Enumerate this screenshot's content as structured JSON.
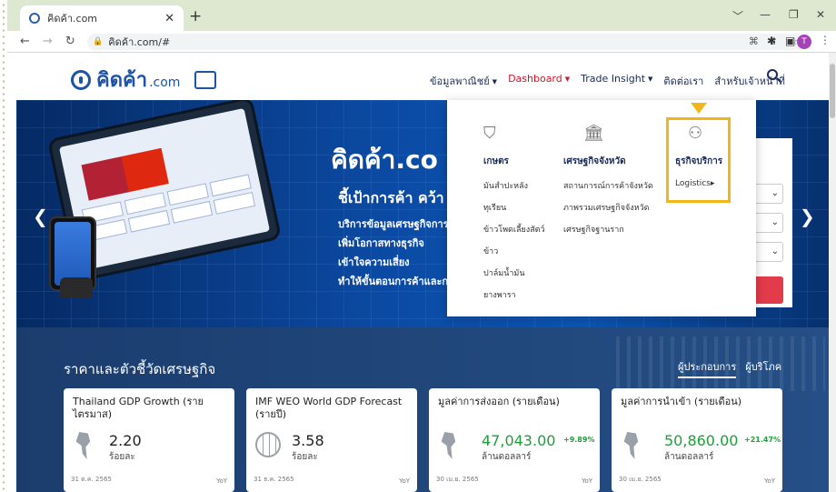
{
  "browser": {
    "tab_title": "คิดค้า.com",
    "tab_close": "✕",
    "new_tab": "+",
    "url": "คิดค้า.com/#",
    "window_controls": [
      "﹀",
      "—",
      "❐",
      "✕"
    ],
    "avatar_initial": "T"
  },
  "header": {
    "logo_text": "คิดค้า",
    "logo_suffix": ".com",
    "nav": [
      {
        "label": "ข้อมูลพาณิชย์",
        "has_caret": true
      },
      {
        "label": "Dashboard",
        "has_caret": true,
        "active": true
      },
      {
        "label": "Trade Insight",
        "has_caret": true
      },
      {
        "label": "ติดต่อเรา",
        "has_caret": false
      },
      {
        "label": "สำหรับเจ้าหน้าที่",
        "has_caret": false
      }
    ]
  },
  "hero": {
    "logo_text": "คิดค้า.co",
    "title": "ชี้เป้าการค้า คว้า",
    "lines": [
      "บริการข้อมูลเศรษฐกิจการ",
      "เพิ่มโอกาสทางธุรกิจ",
      "เข้าใจความเสี่ยง",
      "ทำให้ขั้นตอนการค้าและกา"
    ]
  },
  "dashboard_menu": {
    "columns": [
      {
        "heading": "เกษตร",
        "icon": "plant-icon",
        "items": [
          "มันสำปะหลัง",
          "ทุเรียน",
          "ข้าวโพดเลี้ยงสัตว์",
          "ข้าว",
          "ปาล์มน้ำมัน",
          "ยางพารา"
        ]
      },
      {
        "heading": "เศรษฐกิจจังหวัด",
        "icon": "government-building-icon",
        "items": [
          "สถานการณ์การค้าจังหวัด",
          "ภาพรวมเศรษฐกิจจังหวัด",
          "เศรษฐกิจฐานราก"
        ]
      },
      {
        "heading": "ธุรกิจบริการ",
        "icon": "people-service-icon",
        "items": [
          "Logistics"
        ]
      }
    ]
  },
  "stats": {
    "title": "ราคาและตัวชี้วัดเศรษฐกิจ",
    "tabs": [
      "ผู้ประกอบการ",
      "ผู้บริโภค"
    ],
    "cards": [
      {
        "title": "Thailand GDP Growth (รายไตรมาส)",
        "value": "2.20",
        "unit": "ร้อยละ",
        "change": "",
        "date": "31 ต.ค. 2565",
        "yoy": "YoY",
        "icon": "thailand-map-icon"
      },
      {
        "title": "IMF WEO World GDP Forecast (รายปี)",
        "value": "3.58",
        "unit": "ร้อยละ",
        "change": "",
        "date": "31 ธ.ค. 2565",
        "yoy": "YoY",
        "icon": "globe-icon"
      },
      {
        "title": "มูลค่าการส่งออก (รายเดือน)",
        "value": "47,043.00",
        "unit": "ล้านดอลลาร์",
        "change": "+9.89%",
        "date": "30 เม.ย. 2565",
        "yoy": "YoY",
        "icon": "export-map-icon"
      },
      {
        "title": "มูลค่าการนำเข้า (รายเดือน)",
        "value": "50,860.00",
        "unit": "ล้านดอลลาร์",
        "change": "+21.47%",
        "date": "30 เม.ย. 2565",
        "yoy": "YoY",
        "icon": "import-map-icon"
      }
    ]
  },
  "colors": {
    "accent_red": "#d2142a",
    "highlight": "#f2b51a",
    "brand_blue": "#1d54a6"
  }
}
